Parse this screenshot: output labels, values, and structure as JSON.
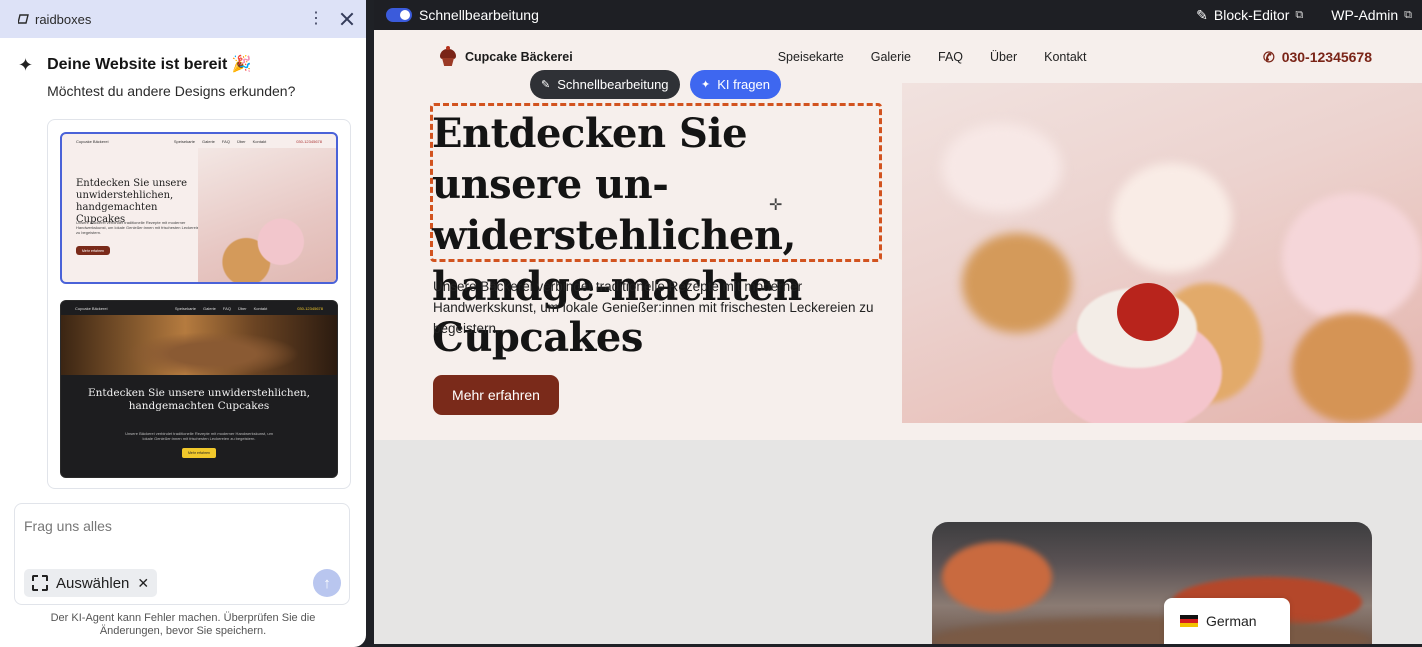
{
  "assistant": {
    "brand": "raidboxes",
    "ready_title": "Deine Website ist bereit 🎉",
    "ready_subtitle": "Möchtest du andere Designs erkunden?",
    "design_previews": [
      {
        "brand": "Cupcake Bäckerei",
        "nav": [
          "Speisekarte",
          "Galerie",
          "FAQ",
          "Über",
          "Kontakt"
        ],
        "phone": "030-12345678",
        "title": "Entdecken Sie unsere unwiderstehlichen, handgemachten Cupcakes",
        "text": "Unsere Bäckerei verbindet traditionelle Rezepte mit moderner Handwerkskunst, um lokale Genießer:innen mit frischesten Leckereien zu begeistern.",
        "button": "Mehr erfahren"
      },
      {
        "brand": "Cupcake Bäckerei",
        "nav": [
          "Speisekarte",
          "Galerie",
          "FAQ",
          "Über",
          "Kontakt"
        ],
        "phone": "030-12345678",
        "title": "Entdecken Sie unsere unwiderstehlichen, handgemachten Cupcakes",
        "text": "Unsere Bäckerei verbindet traditionelle Rezepte mit moderner Handwerkskunst, um lokale Genießer:innen mit frischesten Leckereien zu begeistern.",
        "button": "Mehr erfahren"
      }
    ],
    "chat_placeholder": "Frag uns alles",
    "select_chip": "Auswählen",
    "disclaimer": "Der KI-Agent kann Fehler machen. Überprüfen Sie die Änderungen, bevor Sie speichern."
  },
  "topbar": {
    "quick_edit_label": "Schnellbearbeitung",
    "block_editor": "Block-Editor",
    "wp_admin": "WP-Admin"
  },
  "site": {
    "brand": "Cupcake Bäckerei",
    "menu": [
      "Speisekarte",
      "Galerie",
      "FAQ",
      "Über",
      "Kontakt"
    ],
    "phone": "030-12345678",
    "pill_quick_edit": "Schnellbearbeitung",
    "pill_ai": "KI fragen",
    "headline": "Entdecken Sie unsere un-widerstehlichen, handge-machten Cupcakes",
    "lead": "Unsere Bäckerei verbindet traditionelle Rezepte mit moderner Handwerkskunst, um lokale Genießer:innen mit frischesten Leckereien zu begeistern.",
    "cta": "Mehr erfahren",
    "language": "German"
  },
  "icons": {
    "sparkle": "sparkle-icon",
    "kebab": "more-vertical-icon",
    "close": "close-icon",
    "send": "arrow-up-icon",
    "external": "external-link-icon",
    "pencil": "pencil-icon",
    "phone": "phone-icon"
  },
  "colors": {
    "accent_blue": "#3e67f0",
    "selection_orange": "#d2531f",
    "brand_brown": "#7a2a1a",
    "panel_header": "#dde2f7",
    "topbar": "#1e1f24"
  }
}
